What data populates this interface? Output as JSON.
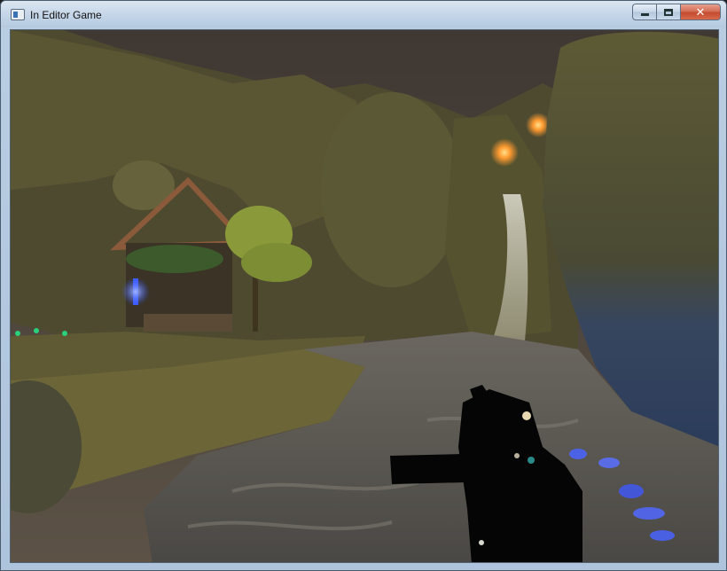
{
  "window": {
    "title": "In Editor Game",
    "icon": "app-window-icon",
    "buttons": {
      "minimize_icon": "minimize-icon",
      "maximize_icon": "maximize-icon",
      "close_label": "✕"
    }
  },
  "scene": {
    "sky_color": "#4a4038",
    "water_color": "#5c5a55",
    "rock_color": "#5e5a36",
    "weapon_color": "#050505",
    "crystal_color": "#3d5cff",
    "torch_color": "#ffb040"
  }
}
